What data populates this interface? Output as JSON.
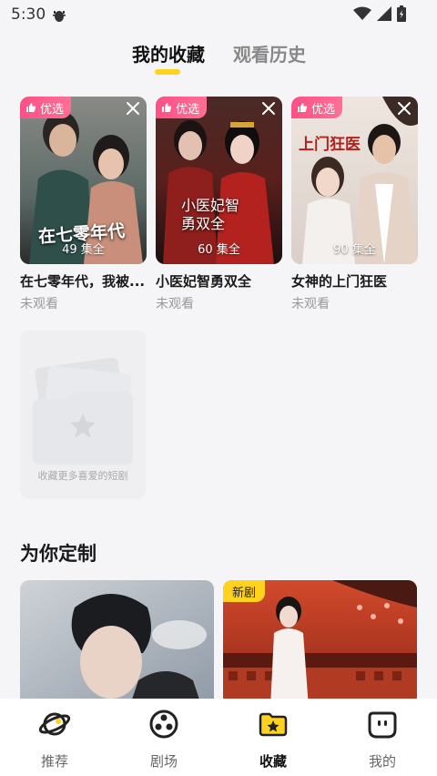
{
  "status_bar": {
    "time": "5:30"
  },
  "tabs": {
    "favorites": "我的收藏",
    "history": "观看历史"
  },
  "favorites": [
    {
      "badge": "优选",
      "episodes": "49 集全",
      "title": "在七零年代，我被...",
      "status": "未观看",
      "poster_text": "在七零年代"
    },
    {
      "badge": "优选",
      "episodes": "60 集全",
      "title": "小医妃智勇双全",
      "status": "未观看",
      "poster_text": "小医妃智勇双全"
    },
    {
      "badge": "优选",
      "episodes": "90 集全",
      "title": "女神的上门狂医",
      "status": "未观看",
      "poster_text": "上门狂医"
    }
  ],
  "empty_slot": {
    "text": "收藏更多喜爱的短剧"
  },
  "section": {
    "title": "为你定制"
  },
  "recommend": [
    {
      "badge": ""
    },
    {
      "badge": "新剧"
    }
  ],
  "bottom_nav": [
    {
      "label": "推荐",
      "icon": "planet-icon"
    },
    {
      "label": "剧场",
      "icon": "film-reel-icon"
    },
    {
      "label": "收藏",
      "icon": "folder-star-icon"
    },
    {
      "label": "我的",
      "icon": "face-icon"
    }
  ],
  "colors": {
    "accent_yellow": "#ffd21e",
    "badge_pink": "#ff4f86",
    "background": "#f5f5f7"
  }
}
